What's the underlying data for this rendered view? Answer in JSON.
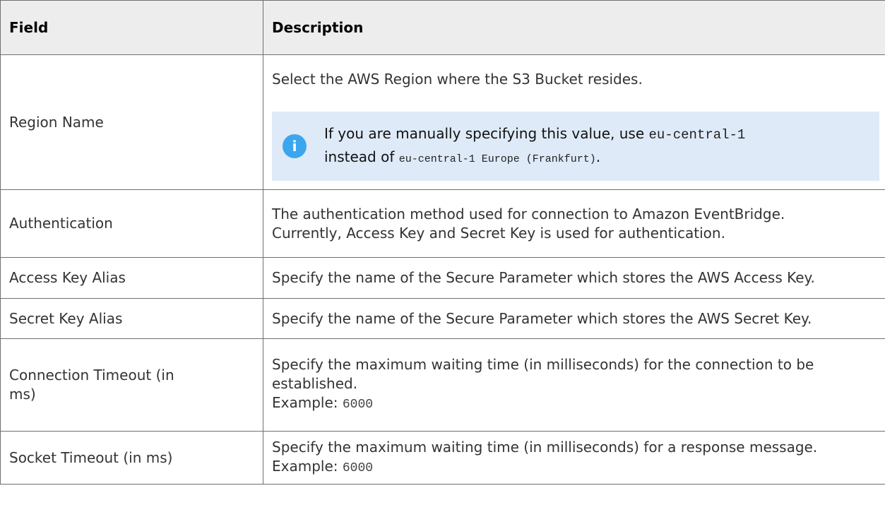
{
  "table": {
    "headers": [
      "Field",
      "Description"
    ],
    "rows": {
      "region": {
        "field": "Region Name",
        "description": "Select the AWS Region where the S3 Bucket resides.",
        "note": {
          "text_before": "If you are manually specifying this value, use",
          "code1": "eu-central-1",
          "text_middle": "instead of",
          "code2": "eu-central-1 Europe (Frankfurt)",
          "text_after": "."
        }
      },
      "auth": {
        "field": "Authentication",
        "line1": "The authentication method used for connection to Amazon EventBridge.",
        "line2": "Currently, Access Key and Secret Key is used for authentication."
      },
      "access": {
        "field": "Access Key Alias",
        "description": "Specify the name of the Secure Parameter which stores the AWS Access Key."
      },
      "secret": {
        "field": "Secret Key Alias",
        "description": "Specify the name of the Secure Parameter which stores the AWS Secret Key."
      },
      "connection": {
        "field_line1": "Connection Timeout (in",
        "field_line2": "ms)",
        "line1": "Specify the maximum waiting time (in milliseconds) for the connection to be",
        "line2": "established.",
        "example_label": "Example:",
        "example_value": "6000"
      },
      "socket": {
        "field": "Socket Timeout (in ms)",
        "line1": "Specify the maximum waiting time (in milliseconds) for a response message.",
        "example_label": "Example:",
        "example_value": "6000"
      }
    }
  },
  "icons": {
    "note_icon": "info-icon",
    "note_icon_glyph": "i"
  },
  "colors": {
    "header_bg": "#ededed",
    "note_bg": "#deeaf7",
    "info_icon": "#3ba6ee",
    "border": "#6f6f6f"
  }
}
